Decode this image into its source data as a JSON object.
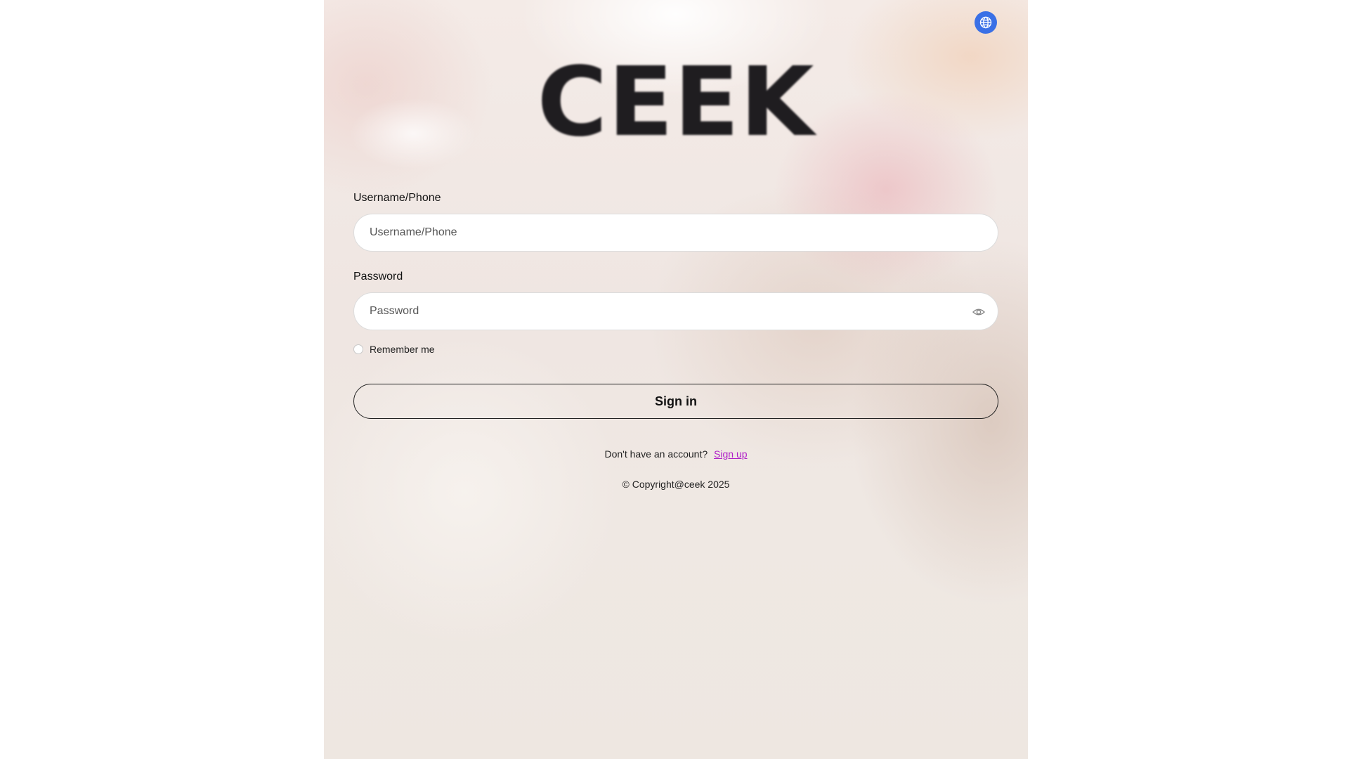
{
  "app": {
    "logo_text": "CEEK",
    "language_icon": "globe-icon",
    "accent_color": "#3a70e6"
  },
  "form": {
    "username": {
      "label": "Username/Phone",
      "placeholder": "Username/Phone",
      "value": ""
    },
    "password": {
      "label": "Password",
      "placeholder": "Password",
      "value": "",
      "toggle_icon": "eye-icon"
    },
    "remember_me": {
      "label": "Remember me",
      "checked": false
    },
    "submit_label": "Sign in"
  },
  "footer": {
    "signup_prompt": "Don't have an account?",
    "signup_link": "Sign up",
    "signup_link_color": "#b020c8",
    "copyright": "© Copyright@ceek 2025"
  }
}
